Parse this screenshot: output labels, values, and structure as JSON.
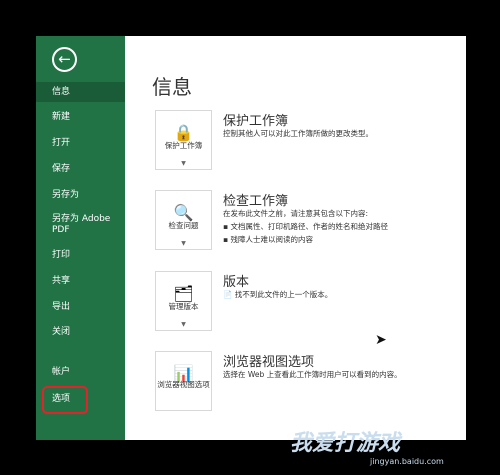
{
  "sidebar": {
    "back_icon": "back-arrow-icon",
    "items": [
      {
        "label": "信息",
        "active": true
      },
      {
        "label": "新建"
      },
      {
        "label": "打开"
      },
      {
        "label": "保存"
      },
      {
        "label": "另存为"
      },
      {
        "label": "另存为 Adobe\nPDF"
      },
      {
        "label": "打印"
      },
      {
        "label": "共享"
      },
      {
        "label": "导出"
      },
      {
        "label": "关闭"
      },
      {
        "label": "帐户"
      },
      {
        "label": "选项"
      }
    ]
  },
  "main": {
    "title": "信息",
    "sections": [
      {
        "tile": "保护工作簿",
        "title": "保护工作簿",
        "desc": "控制其他人可以对此工作簿所做的更改类型。"
      },
      {
        "tile": "检查问题",
        "title": "检查工作簿",
        "desc": "在发布此文件之前，请注意其包含以下内容:",
        "bullets": [
          "文档属性、打印机路径、作者的姓名和绝对路径",
          "残障人士难以阅读的内容"
        ]
      },
      {
        "tile": "管理版本",
        "title": "版本",
        "desc": "找不到此文件的上一个版本。"
      },
      {
        "tile": "浏览器视图选项",
        "title": "浏览器视图选项",
        "desc": "选择在 Web 上查看此工作簿时用户可以看到的内容。"
      }
    ]
  },
  "watermark": {
    "text": "我爱打游戏",
    "url": "jingyan.baidu.com"
  }
}
